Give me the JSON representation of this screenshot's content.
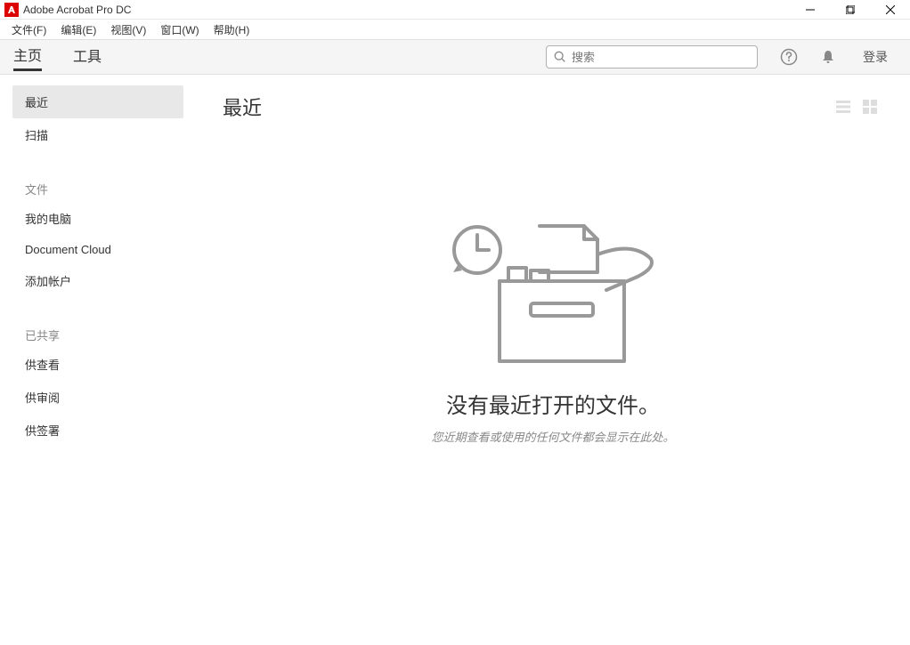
{
  "window": {
    "title": "Adobe Acrobat Pro DC"
  },
  "menubar": {
    "file": "文件(F)",
    "edit": "编辑(E)",
    "view": "视图(V)",
    "window": "窗口(W)",
    "help": "帮助(H)"
  },
  "toolbar": {
    "tab_home": "主页",
    "tab_tools": "工具",
    "search_placeholder": "搜索",
    "login": "登录"
  },
  "sidebar": {
    "recent": "最近",
    "scan": "扫描",
    "files_header": "文件",
    "my_computer": "我的电脑",
    "document_cloud": "Document Cloud",
    "add_account": "添加帐户",
    "shared_header": "已共享",
    "for_view": "供查看",
    "for_review": "供审阅",
    "for_sign": "供签署"
  },
  "content": {
    "title": "最近",
    "empty_headline": "没有最近打开的文件。",
    "empty_subline": "您近期查看或使用的任何文件都会显示在此处。"
  }
}
